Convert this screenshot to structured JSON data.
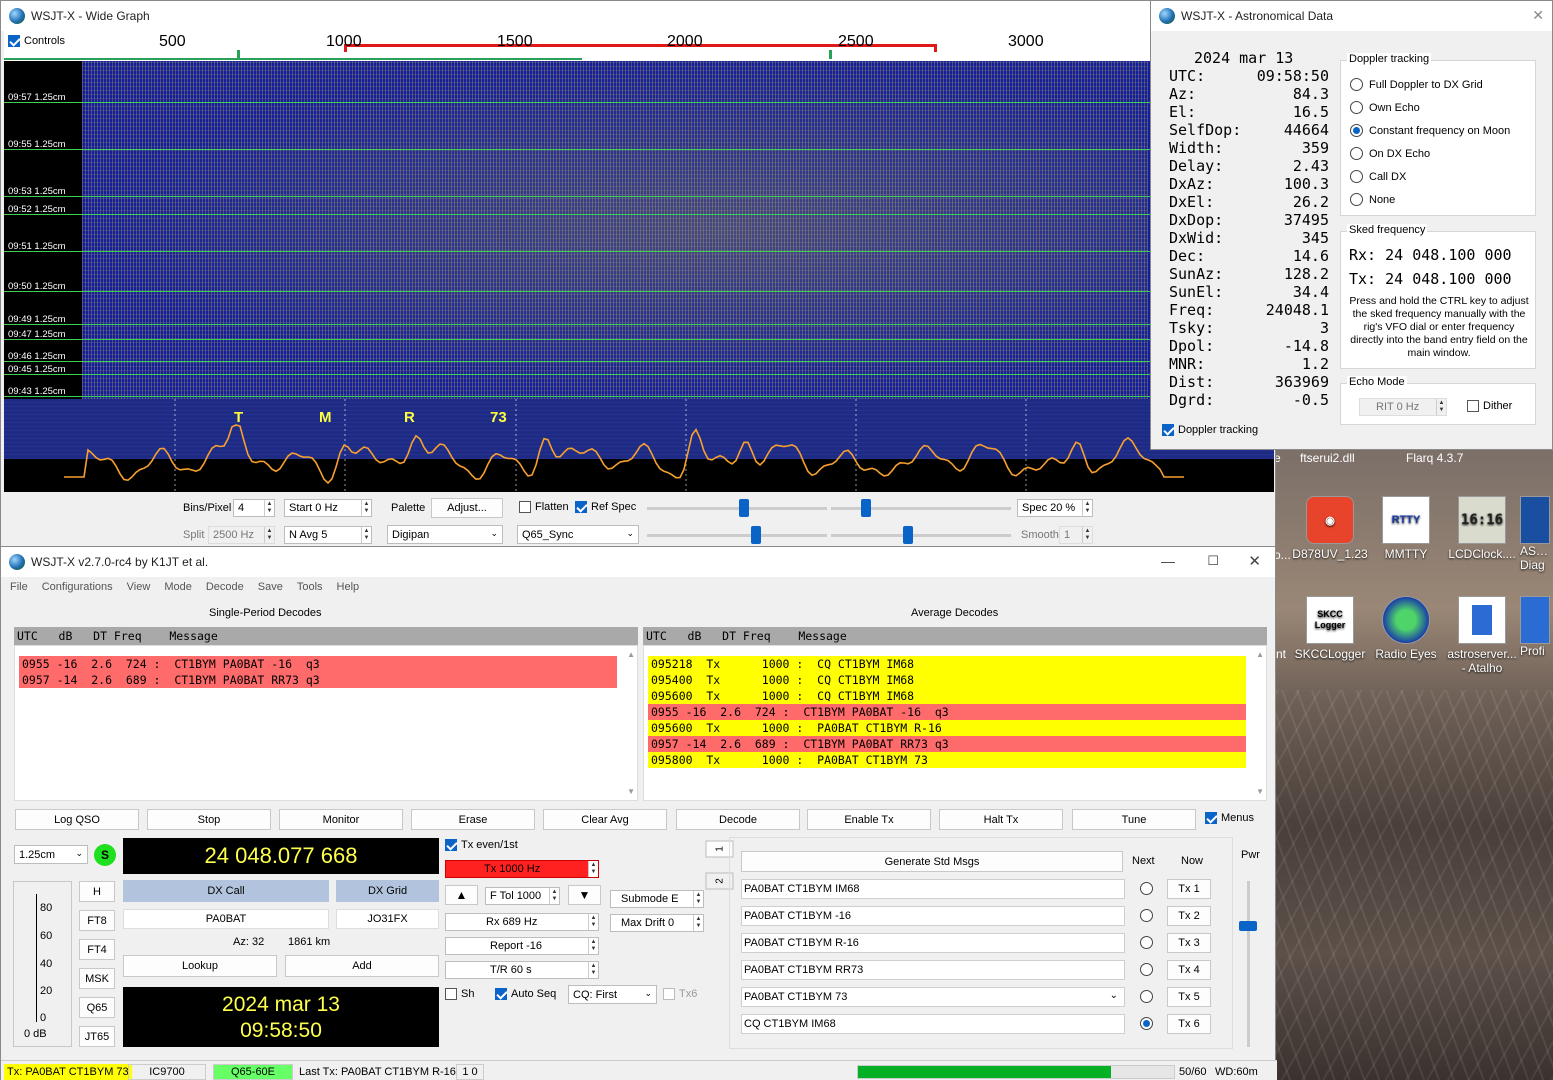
{
  "colors": {
    "waterfall_bg": "#1e2a9a",
    "decode_red": "#ff6b6b",
    "decode_yellow": "#ffff00",
    "clock_bg": "#000000",
    "clock_text": "#ffff4d",
    "tx_red": "#ff2020",
    "spectrum_line": "#f7a030"
  },
  "wide_graph": {
    "title": "WSJT-X - Wide Graph",
    "controls_label": "Controls",
    "freq_ticks": [
      "500",
      "1000",
      "1500",
      "2000",
      "2500",
      "3000"
    ],
    "time_labels": [
      {
        "time": "09:57",
        "res": "1.25cm"
      },
      {
        "time": "09:55",
        "res": "1.25cm"
      },
      {
        "time": "09:53",
        "res": "1.25cm"
      },
      {
        "time": "09:52",
        "res": "1.25cm"
      },
      {
        "time": "09:51",
        "res": "1.25cm"
      },
      {
        "time": "09:50",
        "res": "1.25cm"
      },
      {
        "time": "09:49",
        "res": "1.25cm"
      },
      {
        "time": "09:47",
        "res": "1.25cm"
      },
      {
        "time": "09:46",
        "res": "1.25cm"
      },
      {
        "time": "09:45",
        "res": "1.25cm"
      },
      {
        "time": "09:43",
        "res": "1.25cm"
      }
    ],
    "markers": [
      "T",
      "M",
      "R",
      "73"
    ],
    "bins_pixel_label": "Bins/Pixel",
    "bins_pixel_value": "4",
    "start_value": "Start 0 Hz",
    "split_label": "Split",
    "split_value": "2500 Hz",
    "navg_value": "N Avg 5",
    "palette_label": "Palette",
    "adjust_button": "Adjust...",
    "palette_value": "Digipan",
    "flatten_label": "Flatten",
    "refspec_label": "Ref Spec",
    "spectrum_type": "Q65_Sync",
    "spec_value": "Spec 20 %",
    "smooth_label": "Smooth",
    "smooth_value": "1"
  },
  "astro": {
    "title": "WSJT-X - Astronomical Data",
    "date": "2024 mar 13",
    "rows": [
      {
        "k": "UTC:",
        "v": "09:58:50"
      },
      {
        "k": "Az:",
        "v": "84.3"
      },
      {
        "k": "El:",
        "v": "16.5"
      },
      {
        "k": "SelfDop:",
        "v": "44664"
      },
      {
        "k": "Width:",
        "v": "359"
      },
      {
        "k": "Delay:",
        "v": "2.43"
      },
      {
        "k": "DxAz:",
        "v": "100.3"
      },
      {
        "k": "DxEl:",
        "v": "26.2"
      },
      {
        "k": "DxDop:",
        "v": "37495"
      },
      {
        "k": "DxWid:",
        "v": "345"
      },
      {
        "k": "Dec:",
        "v": "14.6"
      },
      {
        "k": "SunAz:",
        "v": "128.2"
      },
      {
        "k": "SunEl:",
        "v": "34.4"
      },
      {
        "k": "Freq:",
        "v": "24048.1"
      },
      {
        "k": "Tsky:",
        "v": "3"
      },
      {
        "k": "Dpol:",
        "v": "-14.8"
      },
      {
        "k": "MNR:",
        "v": "1.2"
      },
      {
        "k": "Dist:",
        "v": "363969"
      },
      {
        "k": "Dgrd:",
        "v": "-0.5"
      }
    ],
    "doppler_group": "Doppler tracking",
    "doppler_options": [
      "Full Doppler to DX Grid",
      "Own Echo",
      "Constant frequency on Moon",
      "On DX Echo",
      "Call DX",
      "None"
    ],
    "doppler_selected": 2,
    "sked_group": "Sked frequency",
    "sked_rx": "Rx: 24 048.100 000",
    "sked_tx": "Tx: 24 048.100 000",
    "sked_help": "Press and hold the CTRL key to adjust the sked frequency manually with the rig's VFO dial or enter frequency directly into the band entry field on the main window.",
    "echo_group": "Echo Mode",
    "rit_value": "RIT 0 Hz",
    "dither_label": "Dither",
    "doppler_checkbox": "Doppler tracking"
  },
  "main": {
    "title": "WSJT-X   v2.7.0-rc4   by K1JT et al.",
    "menu": [
      "File",
      "Configurations",
      "View",
      "Mode",
      "Decode",
      "Save",
      "Tools",
      "Help"
    ],
    "left_panel_title": "Single-Period Decodes",
    "right_panel_title": "Average Decodes",
    "col_header": "UTC   dB   DT Freq    Message",
    "left_rows": [
      {
        "text": "0955 -16  2.6  724 :  CT1BYM PA0BAT -16  q3",
        "color": "red"
      },
      {
        "text": "0957 -14  2.6  689 :  CT1BYM PA0BAT RR73 q3",
        "color": "red"
      }
    ],
    "right_rows": [
      {
        "text": "095218  Tx      1000 :  CQ CT1BYM IM68",
        "color": "yellow"
      },
      {
        "text": "095400  Tx      1000 :  CQ CT1BYM IM68",
        "color": "yellow"
      },
      {
        "text": "095600  Tx      1000 :  CQ CT1BYM IM68",
        "color": "yellow"
      },
      {
        "text": "0955 -16  2.6  724 :  CT1BYM PA0BAT -16  q3",
        "color": "red"
      },
      {
        "text": "095600  Tx      1000 :  PA0BAT CT1BYM R-16",
        "color": "yellow"
      },
      {
        "text": "0957 -14  2.6  689 :  CT1BYM PA0BAT RR73 q3",
        "color": "red"
      },
      {
        "text": "095800  Tx      1000 :  PA0BAT CT1BYM 73",
        "color": "yellow"
      }
    ],
    "buttons": [
      "Log QSO",
      "Stop",
      "Monitor",
      "Erase",
      "Clear Avg",
      "Decode",
      "Enable Tx",
      "Halt Tx",
      "Tune"
    ],
    "menus_label": "Menus",
    "band": "1.25cm",
    "s_label": "S",
    "dial_freq": "24 048.077 668",
    "dx_call_label": "DX Call",
    "dx_grid_label": "DX Grid",
    "dx_call": "PA0BAT",
    "dx_grid": "JO31FX",
    "az": "Az: 32",
    "dist": "1861 km",
    "lookup": "Lookup",
    "add": "Add",
    "clock_date": "2024 mar 13",
    "clock_time": "09:58:50",
    "mode_buttons": [
      "H",
      "FT8",
      "FT4",
      "MSK",
      "Q65",
      "JT65"
    ],
    "meter_ticks": [
      "80",
      "60",
      "40",
      "20",
      "0"
    ],
    "meter_db": "0 dB",
    "tx_even": "Tx even/1st",
    "tx_freq": "Tx  1000  Hz",
    "ftol": "F Tol  1000",
    "rx_freq": "Rx  689  Hz",
    "report": "Report -16",
    "tr": "T/R  60  s",
    "submode": "Submode E",
    "max_drift": "Max Drift  0",
    "sh": "Sh",
    "auto_seq": "Auto Seq",
    "cq_first": "CQ: First",
    "tx6_check": "Tx6",
    "tab1": "1",
    "tab2": "2",
    "gen_std": "Generate Std Msgs",
    "next": "Next",
    "now": "Now",
    "pwr": "Pwr",
    "tx_msgs": [
      "PA0BAT CT1BYM IM68",
      "PA0BAT CT1BYM -16",
      "PA0BAT CT1BYM R-16",
      "PA0BAT CT1BYM RR73",
      "PA0BAT CT1BYM 73",
      "CQ CT1BYM IM68"
    ],
    "tx_buttons": [
      "Tx 1",
      "Tx 2",
      "Tx 3",
      "Tx 4",
      "Tx 5",
      "Tx 6"
    ],
    "next_selected": 5,
    "status": {
      "tx": "Tx: PA0BAT CT1BYM 73",
      "rig": "IC9700",
      "mode": "Q65-60E",
      "last_tx": "Last Tx: PA0BAT CT1BYM R-16",
      "counter": "1  0",
      "progress_pct": 80,
      "progress_text": "50/60",
      "wd": "WD:60m"
    }
  },
  "desktop": {
    "partial_texts": [
      "e",
      "ftserui2.dll",
      "Flarq 4.3.7"
    ],
    "icons": [
      {
        "label": "D878UV_1.23",
        "glyph": ""
      },
      {
        "label": "MMTTY",
        "glyph": "RTTY"
      },
      {
        "label": "LCDClock....",
        "glyph": "16:16"
      },
      {
        "label": "AS…\nDiag",
        "glyph": ""
      },
      {
        "label": "SKCCLogger",
        "glyph": "SKCC Logger"
      },
      {
        "label": "Radio Eyes",
        "glyph": ""
      },
      {
        "label": "astroserver...\n- Atalho",
        "glyph": ""
      },
      {
        "label": "Profi",
        "glyph": ""
      }
    ],
    "left_edge_texts": [
      "o...",
      "nt"
    ]
  }
}
